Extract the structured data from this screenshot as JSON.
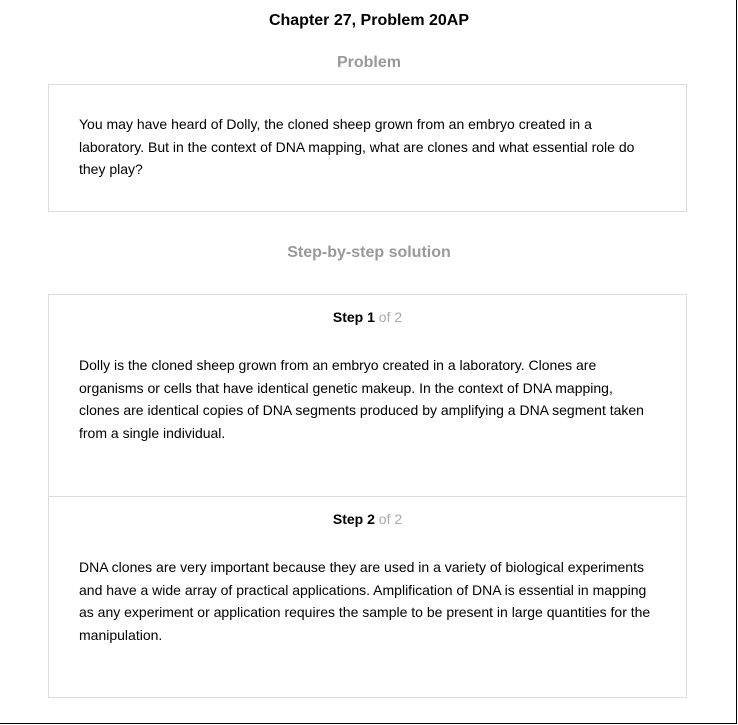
{
  "header": {
    "title": "Chapter 27, Problem 20AP"
  },
  "problem": {
    "heading": "Problem",
    "text": "You may have heard of Dolly, the cloned sheep grown from an embryo created in a laboratory. But in the context of DNA mapping, what are clones and what essential role do they play?"
  },
  "solution": {
    "heading": "Step-by-step solution",
    "steps": [
      {
        "label": "Step",
        "number": "1",
        "of_text": "of 2",
        "text": "Dolly is the cloned sheep grown from an embryo created in a laboratory. Clones are organisms or cells that have identical genetic makeup. In the context of DNA mapping, clones are identical copies of DNA segments produced by amplifying a DNA segment taken from a single individual."
      },
      {
        "label": "Step",
        "number": "2",
        "of_text": "of 2",
        "text": "DNA clones are very important because they are used in a variety of biological experiments and have a wide array of practical applications. Amplification of DNA is essential in mapping as any experiment or application requires the sample to be present in large quantities for the manipulation."
      }
    ]
  }
}
